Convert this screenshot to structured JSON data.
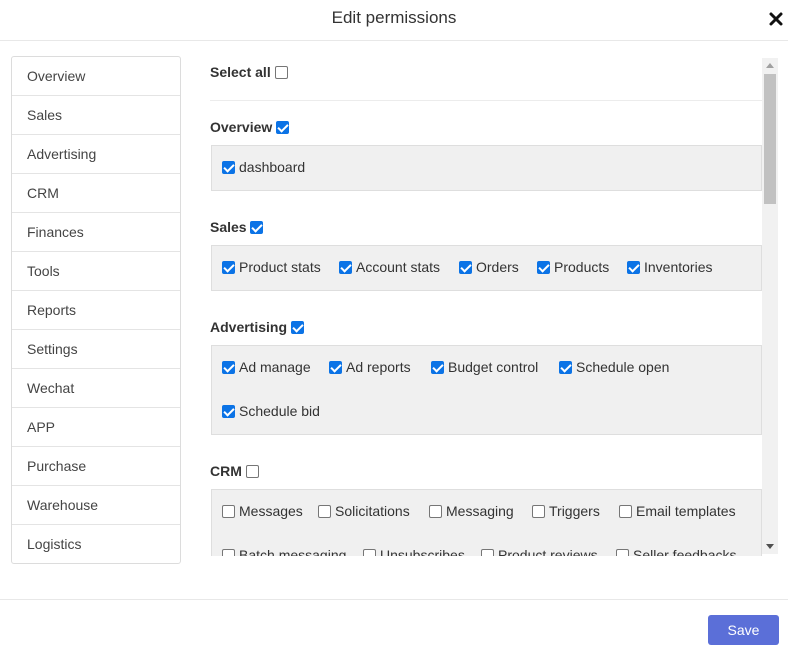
{
  "dialog": {
    "title": "Edit permissions",
    "close_icon": "close-icon",
    "save_label": "Save",
    "accent_color": "#5b6fd8"
  },
  "sidebar": {
    "items": [
      {
        "label": "Overview"
      },
      {
        "label": "Sales"
      },
      {
        "label": "Advertising"
      },
      {
        "label": "CRM"
      },
      {
        "label": "Finances"
      },
      {
        "label": "Tools"
      },
      {
        "label": "Reports"
      },
      {
        "label": "Settings"
      },
      {
        "label": "Wechat"
      },
      {
        "label": "APP"
      },
      {
        "label": "Purchase"
      },
      {
        "label": "Warehouse"
      },
      {
        "label": "Logistics"
      }
    ]
  },
  "permissions": {
    "select_all": {
      "label": "Select all",
      "checked": false
    },
    "groups": [
      {
        "title": "Overview",
        "checked": true,
        "options": [
          {
            "label": "dashboard",
            "checked": true
          }
        ]
      },
      {
        "title": "Sales",
        "checked": true,
        "options": [
          {
            "label": "Product stats",
            "checked": true
          },
          {
            "label": "Account stats",
            "checked": true
          },
          {
            "label": "Orders",
            "checked": true
          },
          {
            "label": "Products",
            "checked": true
          },
          {
            "label": "Inventories",
            "checked": true
          }
        ]
      },
      {
        "title": "Advertising",
        "checked": true,
        "options": [
          {
            "label": "Ad manage",
            "checked": true
          },
          {
            "label": "Ad reports",
            "checked": true
          },
          {
            "label": "Budget control",
            "checked": true
          },
          {
            "label": "Schedule open",
            "checked": true
          },
          {
            "label": "Schedule bid",
            "checked": true
          }
        ]
      },
      {
        "title": "CRM",
        "checked": false,
        "options": [
          {
            "label": "Messages",
            "checked": false
          },
          {
            "label": "Solicitations",
            "checked": false
          },
          {
            "label": "Messaging",
            "checked": false
          },
          {
            "label": "Triggers",
            "checked": false
          },
          {
            "label": "Email templates",
            "checked": false
          },
          {
            "label": "Batch messaging",
            "checked": false
          },
          {
            "label": "Unsubscribes",
            "checked": false
          },
          {
            "label": "Product reviews",
            "checked": false
          },
          {
            "label": "Seller feedbacks",
            "checked": false
          }
        ]
      }
    ]
  }
}
